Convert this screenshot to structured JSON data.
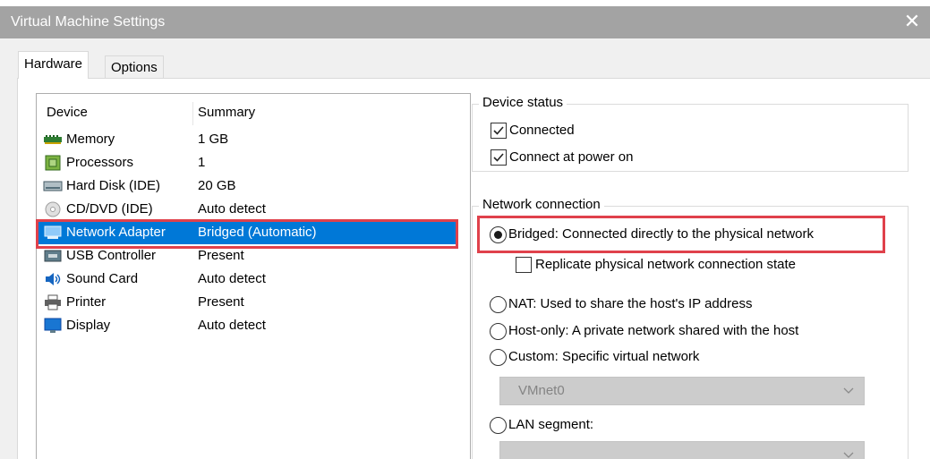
{
  "window": {
    "title": "Virtual Machine Settings",
    "close_glyph": "✕"
  },
  "tabs": [
    {
      "label": "Hardware",
      "active": true
    },
    {
      "label": "Options",
      "active": false
    }
  ],
  "device_list": {
    "columns": [
      "Device",
      "Summary"
    ],
    "rows": [
      {
        "icon": "memory-icon",
        "device": "Memory",
        "summary": "1 GB"
      },
      {
        "icon": "processor-icon",
        "device": "Processors",
        "summary": "1"
      },
      {
        "icon": "hard-disk-icon",
        "device": "Hard Disk (IDE)",
        "summary": "20 GB"
      },
      {
        "icon": "cd-dvd-icon",
        "device": "CD/DVD (IDE)",
        "summary": "Auto detect"
      },
      {
        "icon": "network-adapter-icon",
        "device": "Network Adapter",
        "summary": "Bridged (Automatic)",
        "selected": true
      },
      {
        "icon": "usb-controller-icon",
        "device": "USB Controller",
        "summary": "Present"
      },
      {
        "icon": "sound-card-icon",
        "device": "Sound Card",
        "summary": "Auto detect"
      },
      {
        "icon": "printer-icon",
        "device": "Printer",
        "summary": "Present"
      },
      {
        "icon": "display-icon",
        "device": "Display",
        "summary": "Auto detect"
      }
    ]
  },
  "device_status": {
    "legend": "Device status",
    "connected": {
      "label": "Connected",
      "checked": true
    },
    "connect_at_power_on": {
      "label": "Connect at power on",
      "checked": true
    }
  },
  "network_connection": {
    "legend": "Network connection",
    "bridged": {
      "label": "Bridged: Connected directly to the physical network",
      "selected": true
    },
    "replicate": {
      "label": "Replicate physical network connection state",
      "checked": false
    },
    "nat": {
      "label": "NAT: Used to share the host's IP address",
      "selected": false
    },
    "host_only": {
      "label": "Host-only: A private network shared with the host",
      "selected": false
    },
    "custom": {
      "label": "Custom: Specific virtual network",
      "selected": false
    },
    "custom_network_value": "VMnet0",
    "lan_segment": {
      "label": "LAN segment:",
      "selected": false
    },
    "lan_segment_value": ""
  },
  "colors": {
    "title_bar": "#a3a3a3",
    "selection": "#0078d7",
    "highlight_box": "#e0414b"
  }
}
